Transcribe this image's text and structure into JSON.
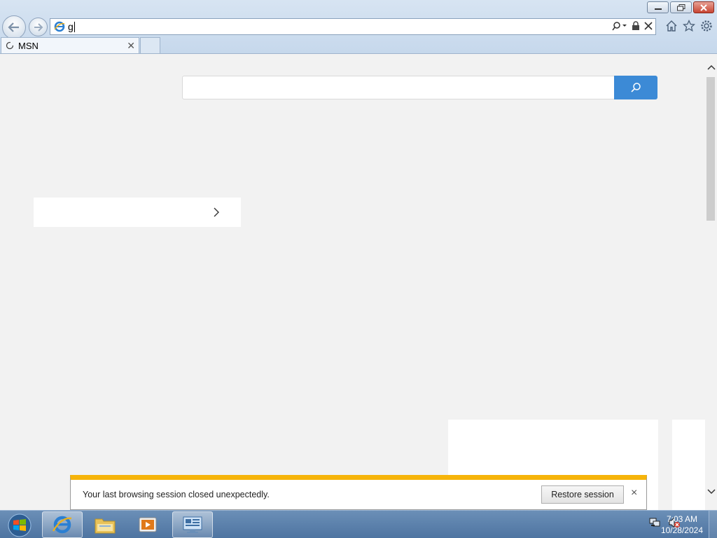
{
  "browser": {
    "address_value": "g",
    "tab_title": "MSN"
  },
  "notification": {
    "message": "Your last browsing session closed unexpectedly.",
    "button_label": "Restore session",
    "close_glyph": "×"
  },
  "clock": {
    "time": "7:03 AM",
    "date": "10/28/2024"
  },
  "colors": {
    "search_button": "#3c8ad6",
    "notification_bar": "#f6b40a"
  }
}
